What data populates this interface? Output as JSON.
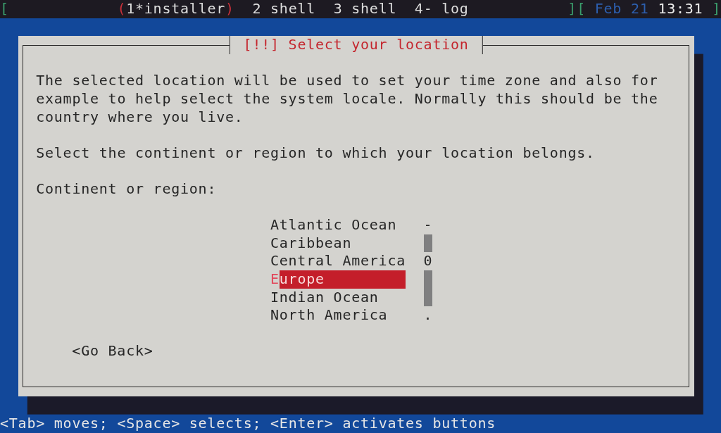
{
  "status_bar": {
    "open_bracket": "[",
    "windows": [
      {
        "label": "1*installer",
        "selected": true
      },
      {
        "label": "2 shell",
        "selected": false
      },
      {
        "label": "3 shell",
        "selected": false
      },
      {
        "label": "4- log",
        "selected": false
      }
    ],
    "current_marks": [
      "(",
      ")"
    ],
    "separator": "][",
    "date": "Feb 21",
    "time": "13:31",
    "close_bracket": "]"
  },
  "dialog": {
    "title": "[!!] Select your location",
    "paragraphs": [
      "The selected location will be used to set your time zone and also for example to help select the system locale. Normally this should be the country where you live.",
      "Select the continent or region to which your location belongs."
    ],
    "list_label": "Continent or region:",
    "list": {
      "items": [
        {
          "label": "Atlantic Ocean",
          "selected": false
        },
        {
          "label": "Caribbean",
          "selected": false
        },
        {
          "label": "Central America",
          "selected": false
        },
        {
          "label": "Europe",
          "selected": true
        },
        {
          "label": "Indian Ocean",
          "selected": false
        },
        {
          "label": "North America",
          "selected": false
        }
      ],
      "scrollbar": {
        "top_mark": "-",
        "thumb": "0",
        "bottom_mark": "."
      }
    },
    "buttons": [
      {
        "label": "<Go Back>"
      }
    ]
  },
  "help_line": "<Tab> moves; <Space> selects; <Enter> activates buttons"
}
